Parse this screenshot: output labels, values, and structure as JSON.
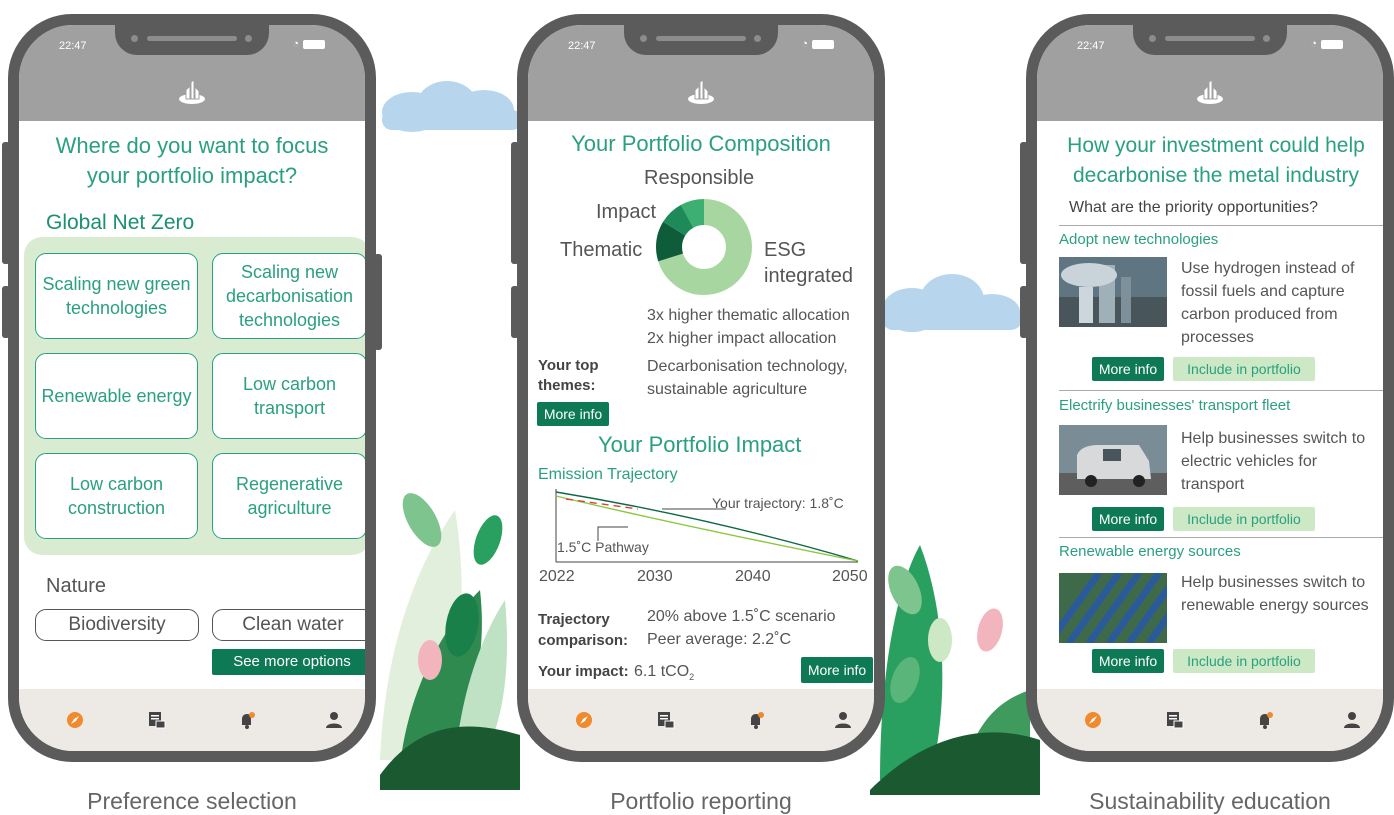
{
  "status_bar": {
    "time": "22:47"
  },
  "phone1": {
    "title": "Where do you want to focus your portfolio impact?",
    "section1": "Global Net Zero",
    "options": [
      "Scaling new green technologies",
      "Scaling new decarbonisation technologies",
      "Renewable energy",
      "Low carbon transport",
      "Low carbon construction",
      "Regenerative agriculture"
    ],
    "section2": "Nature",
    "nature_options": [
      "Biodiversity",
      "Clean water"
    ],
    "see_more": "See more options",
    "caption": "Preference selection"
  },
  "phone2": {
    "title": "Your Portfolio Composition",
    "donut_labels": {
      "responsible": "Responsible",
      "impact": "Impact",
      "thematic": "Thematic",
      "esg": "ESG integrated"
    },
    "alloc1": "3x higher thematic allocation",
    "alloc2": "2x higher impact allocation",
    "themes_label": "Your top themes:",
    "themes_value": "Decarbonisation technology, sustainable agriculture",
    "more_info": "More info",
    "impact_title": "Your Portfolio Impact",
    "trajectory_label": "Emission Trajectory",
    "your_trajectory": "Your trajectory: 1.8˚C",
    "pathway": "1.5˚C Pathway",
    "years": [
      "2022",
      "2030",
      "2040",
      "2050"
    ],
    "comparison_label": "Trajectory comparison:",
    "comparison1": "20% above 1.5˚C scenario",
    "comparison2": "Peer average: 2.2˚C",
    "impact_label": "Your impact:",
    "impact_value": "6.1 tCO",
    "impact_sub": "2",
    "caption": "Portfolio reporting"
  },
  "phone3": {
    "title": "How your investment could help decarbonise the metal industry",
    "question": "What are the priority opportunities?",
    "items": [
      {
        "heading": "Adopt new technologies",
        "text": "Use hydrogen instead of fossil fuels and capture carbon produced from processes"
      },
      {
        "heading": "Electrify businesses' transport fleet",
        "text": "Help businesses switch to electric vehicles for transport"
      },
      {
        "heading": "Renewable energy sources",
        "text": "Help businesses switch to renewable energy sources"
      }
    ],
    "more_info": "More info",
    "include": "Include in portfolio",
    "caption": "Sustainability education"
  },
  "colors": {
    "accent": "#2aa080",
    "dark_green": "#0e7a55",
    "light_green": "#cde8c4",
    "nav_dot": "#f08a2c"
  },
  "icons": [
    "logo-icon",
    "compass-icon",
    "portfolio-icon",
    "bell-icon",
    "profile-icon"
  ]
}
